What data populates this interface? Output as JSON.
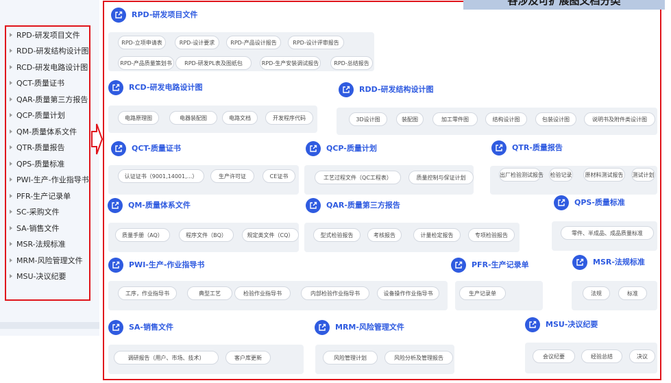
{
  "banner": "各涉及可扩展图文档分类",
  "sidebar": {
    "items": [
      {
        "label": "RPD-研发项目文件"
      },
      {
        "label": "RDD-研发结构设计图"
      },
      {
        "label": "RCD-研发电路设计图"
      },
      {
        "label": "QCT-质量证书"
      },
      {
        "label": "QAR-质量第三方报告"
      },
      {
        "label": "QCP-质量计划"
      },
      {
        "label": "QM-质量体系文件"
      },
      {
        "label": "QTR-质量报告"
      },
      {
        "label": "QPS-质量标准"
      },
      {
        "label": "PWI-生产-作业指导书"
      },
      {
        "label": "PFR-生产记录单"
      },
      {
        "label": "SC-采购文件"
      },
      {
        "label": "SA-销售文件"
      },
      {
        "label": "MSR-法规标准"
      },
      {
        "label": "MRM-风险管理文件"
      },
      {
        "label": "MSU-决议纪要"
      }
    ]
  },
  "categories": [
    {
      "title": "RPD-研发项目文件",
      "icon": "external-link-icon",
      "tags": [
        "RPD-立项申请表",
        "RPD-设计要求",
        "RPD-产品设计报告",
        "RPD-设计评审报告",
        "RPD-产品质量策划书",
        "RPD-研发PL表及图纸包",
        "RPD-生产安装调试报告",
        "RPD-总结报告"
      ]
    },
    {
      "title": "RCD-研发电路设计图",
      "icon": "external-link-icon",
      "tags": [
        "电路原理图",
        "电器装配图",
        "电路文档",
        "开发程序代码"
      ]
    },
    {
      "title": "RDD-研发结构设计图",
      "icon": "external-link-icon",
      "tags": [
        "3D设计图",
        "装配图",
        "加工零件图",
        "结构设计图",
        "包装设计图",
        "说明书及附件类设计图"
      ]
    },
    {
      "title": "QCT-质量证书",
      "icon": "external-link-icon",
      "tags": [
        "认证证书（9001,14001,...）",
        "生产许可证",
        "CE证书"
      ]
    },
    {
      "title": "QCP-质量计划",
      "icon": "external-link-icon",
      "tags": [
        "工艺过程文件（QC工程表）",
        "质量控制与保证计划"
      ]
    },
    {
      "title": "QTR-质量报告",
      "icon": "external-link-icon",
      "tags": [
        "出厂检验测试报告",
        "检验记录",
        "原材料测试报告",
        "测试计划"
      ]
    },
    {
      "title": "QM-质量体系文件",
      "icon": "external-link-icon",
      "tags": [
        "质量手册（AQ）",
        "程序文件（BQ）",
        "规定类文件（CQ）"
      ]
    },
    {
      "title": "QAR-质量第三方报告",
      "icon": "external-link-icon",
      "tags": [
        "型式检验报告",
        "考核报告",
        "计量检定报告",
        "专项检验报告"
      ]
    },
    {
      "title": "QPS-质量标准",
      "icon": "external-link-icon",
      "tags": [
        "零件、半成品、成品质量标准"
      ]
    },
    {
      "title": "PWI-生产-作业指导书",
      "icon": "external-link-icon",
      "tags": [
        "工序，作业指导书",
        "典型工艺",
        "检验作业指导书",
        "内部检验作业指导书",
        "设备操作作业指导书"
      ]
    },
    {
      "title": "PFR-生产记录单",
      "icon": "external-link-icon",
      "tags": [
        "生产记录单"
      ]
    },
    {
      "title": "MSR-法规标准",
      "icon": "external-link-icon",
      "tags": [
        "法规",
        "标准"
      ]
    },
    {
      "title": "SA-销售文件",
      "icon": "external-link-icon",
      "tags": [
        "调研报告（用户、市场、技术）",
        "客户库更新"
      ]
    },
    {
      "title": "MRM-风险管理文件",
      "icon": "external-link-icon",
      "tags": [
        "风险管理计划",
        "风险分析及管理报告"
      ]
    },
    {
      "title": "MSU-决议纪要",
      "icon": "external-link-icon",
      "tags": [
        "会议纪要",
        "经验总结",
        "决议"
      ]
    }
  ]
}
